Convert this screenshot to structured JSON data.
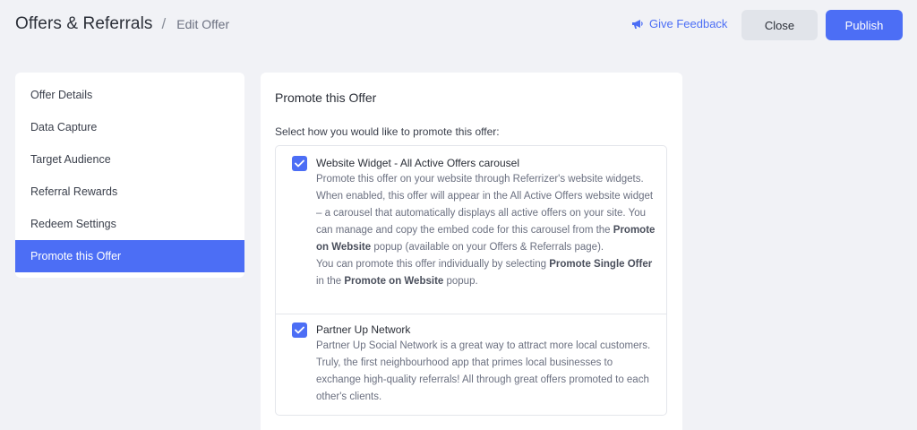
{
  "header": {
    "breadcrumb_root": "Offers & Referrals",
    "breadcrumb_sep": "/",
    "breadcrumb_current": "Edit Offer",
    "feedback_label": "Give Feedback",
    "close_label": "Close",
    "publish_label": "Publish"
  },
  "sidebar": {
    "items": [
      {
        "label": "Offer Details"
      },
      {
        "label": "Data Capture"
      },
      {
        "label": "Target Audience"
      },
      {
        "label": "Referral Rewards"
      },
      {
        "label": "Redeem Settings"
      },
      {
        "label": "Promote this Offer",
        "active": true
      }
    ]
  },
  "main": {
    "title": "Promote this Offer",
    "subtitle": "Select how you would like to promote this offer:",
    "options": [
      {
        "title": "Website Widget - All Active Offers carousel",
        "checked": true,
        "desc_1": "Promote this offer on your website through Referrizer's website widgets. When enabled, this offer will appear in the All Active Offers website widget – a carousel that automatically displays all active offers on your site. You can manage and copy the embed code for this carousel from the ",
        "desc_1_bold": "Promote on Website",
        "desc_1_end": " popup (available on your Offers & Referrals page).",
        "desc_2": "You can promote this offer individually by selecting ",
        "desc_2_bold1": "Promote Single Offer",
        "desc_2_mid": " in the ",
        "desc_2_bold2": "Promote on Website",
        "desc_2_end": " popup."
      },
      {
        "title": "Partner Up Network",
        "checked": true,
        "desc": "Partner Up Social Network is a great way to attract more local customers. Truly, the first neighbourhood app that primes local businesses to exchange high-quality referrals! All through great offers promoted to each other's clients."
      }
    ]
  },
  "colors": {
    "accent": "#4c6ef5",
    "background": "#f1f2f6",
    "close_button": "#e1e4ea"
  },
  "icons": {
    "feedback": "megaphone-icon",
    "checkbox": "checkmark-icon"
  }
}
